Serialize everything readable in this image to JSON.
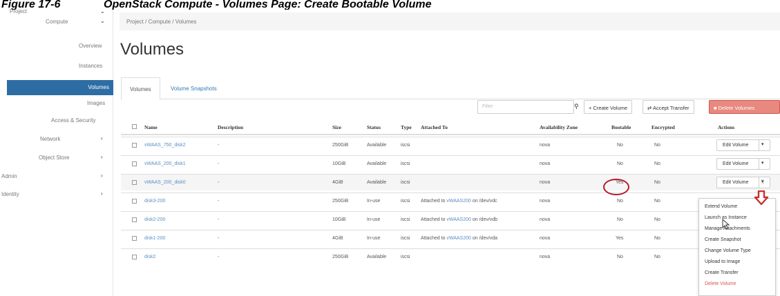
{
  "caption": {
    "figure": "Figure 17-6",
    "text": "OpenStack Compute - Volumes Page: Create Bootable Volume"
  },
  "sidebar": {
    "project": "Project",
    "compute": "Compute",
    "overview": "Overview",
    "instances": "Instances",
    "volumes": "Volumes",
    "images": "Images",
    "access_security": "Access & Security",
    "network": "Network",
    "object_store": "Object Store",
    "admin": "Admin",
    "identity": "Identity"
  },
  "breadcrumb": "Project / Compute / Volumes",
  "page_title": "Volumes",
  "tabs": [
    "Volumes",
    "Volume Snapshots"
  ],
  "toolbar": {
    "filter_placeholder": "Filter",
    "create_volume": "+ Create Volume",
    "accept_transfer": "Accept Transfer",
    "delete_volumes": "Delete Volumes"
  },
  "table": {
    "headers": [
      "Name",
      "Description",
      "Size",
      "Status",
      "Type",
      "Attached To",
      "Availability Zone",
      "Bootable",
      "Encrypted",
      "Actions"
    ],
    "rows": [
      {
        "name": "vWAAS_750_disk2",
        "desc": "-",
        "size": "250GiB",
        "status": "Available",
        "type": "iscsi",
        "attached": "",
        "attached_vm": "",
        "attached_dev": "",
        "zone": "nova",
        "bootable": "No",
        "encrypted": "No"
      },
      {
        "name": "vWAAS_200_disk1",
        "desc": "-",
        "size": "10GiB",
        "status": "Available",
        "type": "iscsi",
        "attached": "",
        "attached_vm": "",
        "attached_dev": "",
        "zone": "nova",
        "bootable": "No",
        "encrypted": "No"
      },
      {
        "name": "vWAAS_200_disk0",
        "desc": "-",
        "size": "4GiB",
        "status": "Available",
        "type": "iscsi",
        "attached": "",
        "attached_vm": "",
        "attached_dev": "",
        "zone": "nova",
        "bootable": "Yes",
        "encrypted": "No"
      },
      {
        "name": "disk3-200",
        "desc": "-",
        "size": "250GiB",
        "status": "In-use",
        "type": "iscsi",
        "attached": "Attached to",
        "attached_vm": "vWAAS200",
        "attached_dev": "on /dev/vdc",
        "zone": "nova",
        "bootable": "No",
        "encrypted": "No"
      },
      {
        "name": "disk2-200",
        "desc": "-",
        "size": "10GiB",
        "status": "In-use",
        "type": "iscsi",
        "attached": "Attached to",
        "attached_vm": "vWAAS200",
        "attached_dev": "on /dev/vdb",
        "zone": "nova",
        "bootable": "No",
        "encrypted": "No"
      },
      {
        "name": "disk1-200",
        "desc": "-",
        "size": "4GiB",
        "status": "In-use",
        "type": "iscsi",
        "attached": "Attached to",
        "attached_vm": "vWAAS200",
        "attached_dev": "on /dev/vda",
        "zone": "nova",
        "bootable": "Yes",
        "encrypted": "No"
      },
      {
        "name": "disk2",
        "desc": "-",
        "size": "250GiB",
        "status": "Available",
        "type": "iscsi",
        "attached": "",
        "attached_vm": "",
        "attached_dev": "",
        "zone": "nova",
        "bootable": "No",
        "encrypted": "No"
      }
    ],
    "action_label": "Edit Volume",
    "caret": "▾"
  },
  "actions_menu": [
    "Extend Volume",
    "Launch as Instance",
    "Manage Attachments",
    "Create Snapshot",
    "Change Volume Type",
    "Upload to Image",
    "Create Transfer",
    "Delete Volume"
  ],
  "colors": {
    "primary": "#2e6da4",
    "link": "#5a8dc5",
    "danger": "#d9534f",
    "highlight": "#b5182a"
  }
}
